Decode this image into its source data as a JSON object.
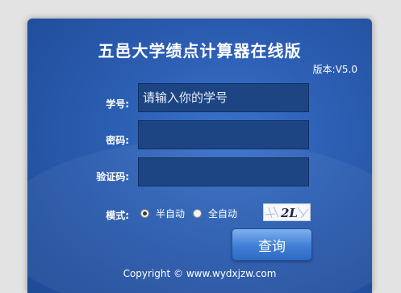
{
  "app": {
    "title": "五邑大学绩点计算器在线版",
    "version": "版本:V5.0"
  },
  "form": {
    "student_id_label": "学号:",
    "student_id_placeholder": "请输入你的学号",
    "student_id_value": "",
    "password_label": "密码:",
    "password_value": "",
    "captcha_label": "验证码:",
    "captcha_value": "",
    "captcha_image_text": "2L",
    "mode_label": "模式:",
    "mode_options": [
      {
        "label": "半自动",
        "checked": true
      },
      {
        "label": "全自动",
        "checked": false
      }
    ],
    "submit_label": "查询"
  },
  "footer": {
    "copyright": "Copyright © www.wydxjzw.com"
  },
  "colors": {
    "panel_blue": "#2a5cb0",
    "field_bg": "#1d4584",
    "button_blue": "#3f7fd6"
  }
}
